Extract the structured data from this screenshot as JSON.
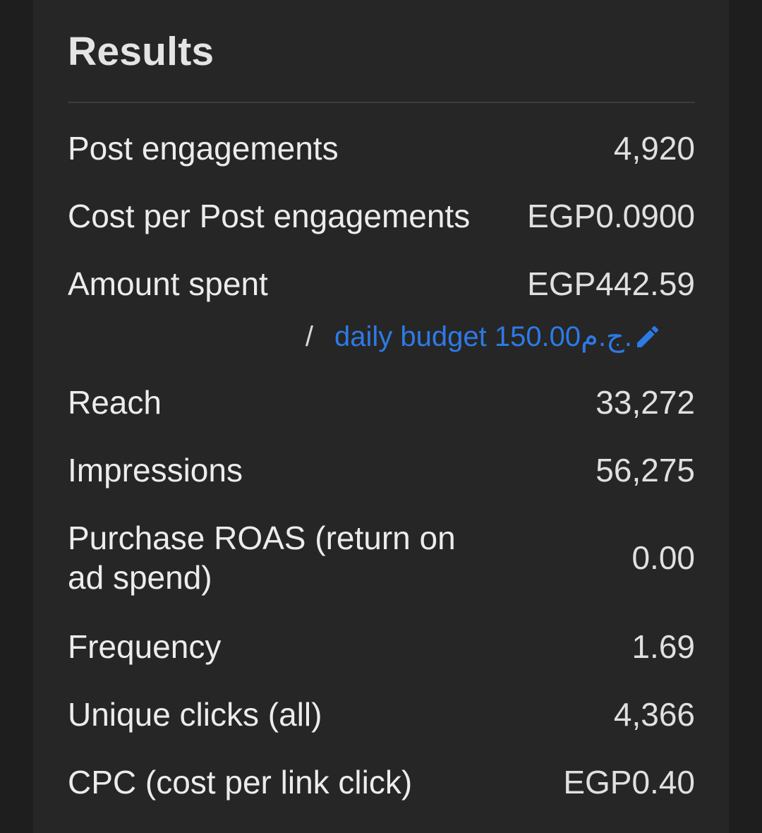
{
  "results": {
    "title": "Results",
    "rows": [
      {
        "label": "Post engagements",
        "value": "4,920"
      },
      {
        "label": "Cost per Post engagements",
        "value": "EGP0.0900"
      },
      {
        "label": "Amount spent",
        "value": "EGP442.59"
      },
      {
        "label": "Reach",
        "value": "33,272"
      },
      {
        "label": "Impressions",
        "value": "56,275"
      },
      {
        "label": "Purchase ROAS (return on ad spend)",
        "value": "0.00"
      },
      {
        "label": "Frequency",
        "value": "1.69"
      },
      {
        "label": "Unique clicks (all)",
        "value": "4,366"
      },
      {
        "label": "CPC (cost per link click)",
        "value": "EGP0.40"
      }
    ],
    "budget": {
      "separator": "/",
      "link_text": "daily budget 150.00ج.م.",
      "edit_icon": "pencil-icon",
      "link_color": "#2d7ae6"
    }
  }
}
